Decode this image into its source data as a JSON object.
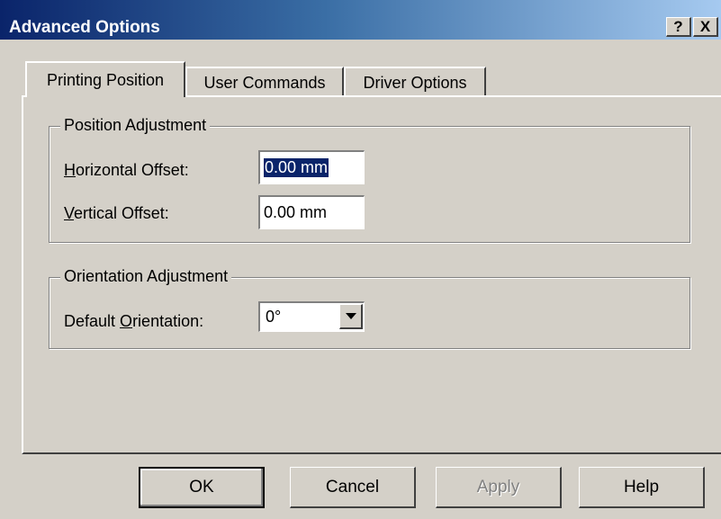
{
  "window": {
    "title": "Advanced Options",
    "help_button": "?",
    "close_button": "X"
  },
  "tabs": [
    {
      "label": "Printing Position",
      "active": true
    },
    {
      "label": "User Commands",
      "active": false
    },
    {
      "label": "Driver Options",
      "active": false
    }
  ],
  "position_adjustment": {
    "legend": "Position Adjustment",
    "horizontal_label_accel": "H",
    "horizontal_label_rest": "orizontal Offset:",
    "horizontal_value": "0.00 mm",
    "vertical_label_accel": "V",
    "vertical_label_rest": "ertical Offset:",
    "vertical_value": "0.00 mm"
  },
  "orientation_adjustment": {
    "legend": "Orientation Adjustment",
    "default_label_pre": "Default ",
    "default_label_accel": "O",
    "default_label_rest": "rientation:",
    "selected_value": "0°"
  },
  "buttons": {
    "ok": "OK",
    "cancel": "Cancel",
    "apply": "Apply",
    "help": "Help"
  },
  "colors": {
    "titlebar_start": "#0a246a",
    "titlebar_end": "#a6caf0",
    "face": "#d4d0c8",
    "selection": "#0a246a"
  }
}
